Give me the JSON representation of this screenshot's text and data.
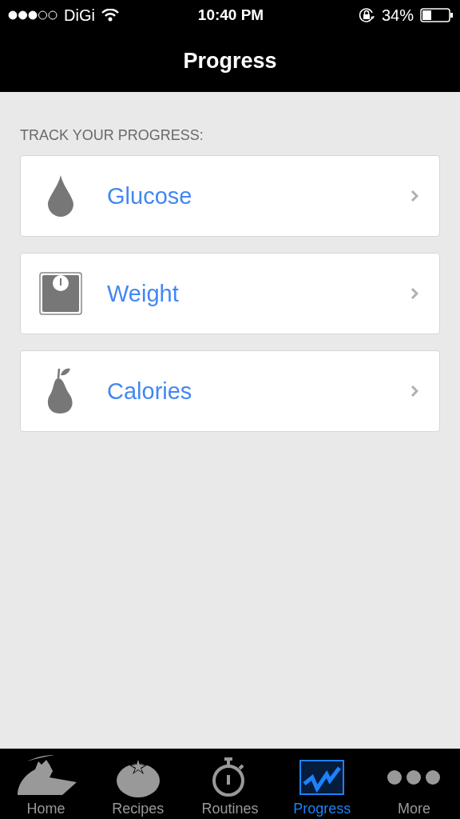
{
  "status_bar": {
    "carrier": "DiGi",
    "time": "10:40 PM",
    "battery": "34%"
  },
  "nav": {
    "title": "Progress"
  },
  "section": {
    "header": "TRACK YOUR PROGRESS:"
  },
  "items": [
    {
      "label": "Glucose",
      "kind": "drop"
    },
    {
      "label": "Weight",
      "kind": "scale"
    },
    {
      "label": "Calories",
      "kind": "pear"
    }
  ],
  "tabs": [
    {
      "label": "Home",
      "kind": "home",
      "selected": false
    },
    {
      "label": "Recipes",
      "kind": "recipes",
      "selected": false
    },
    {
      "label": "Routines",
      "kind": "routines",
      "selected": false
    },
    {
      "label": "Progress",
      "kind": "progress",
      "selected": true
    },
    {
      "label": "More",
      "kind": "more",
      "selected": false
    }
  ]
}
